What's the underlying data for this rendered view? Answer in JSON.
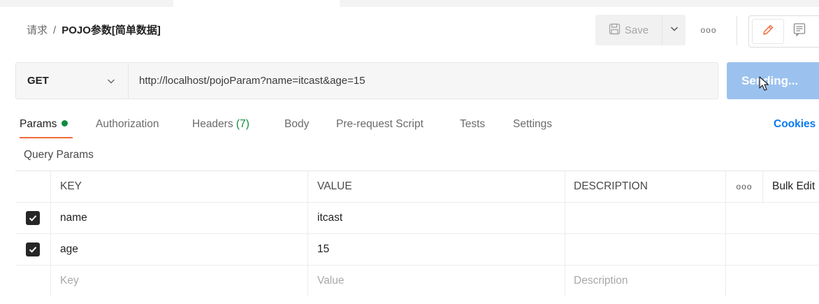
{
  "breadcrumb": {
    "parent": "请求",
    "separator": "/",
    "current": "POJO参数[简单数据]"
  },
  "toolbar": {
    "save_label": "Save",
    "more_label": "ooo"
  },
  "request": {
    "method": "GET",
    "url": "http://localhost/pojoParam?name=itcast&age=15",
    "send_label": "Sending..."
  },
  "tabs": [
    {
      "label": "Params",
      "active": true,
      "indicator": "green-dot"
    },
    {
      "label": "Authorization"
    },
    {
      "label": "Headers",
      "count": "(7)"
    },
    {
      "label": "Body"
    },
    {
      "label": "Pre-request Script"
    },
    {
      "label": "Tests"
    },
    {
      "label": "Settings"
    }
  ],
  "cookies_label": "Cookies",
  "query_params": {
    "title": "Query Params",
    "columns": {
      "key": "KEY",
      "value": "VALUE",
      "description": "DESCRIPTION",
      "more": "ooo",
      "bulk": "Bulk Edit"
    },
    "rows": [
      {
        "checked": true,
        "key": "name",
        "value": "itcast",
        "description": ""
      },
      {
        "checked": true,
        "key": "age",
        "value": "15",
        "description": ""
      }
    ],
    "placeholders": {
      "key": "Key",
      "value": "Value",
      "description": "Description"
    }
  },
  "colors": {
    "accent_tab": "#f26b3a",
    "send_button": "#9bc2ef",
    "link": "#097bed",
    "status_green": "#0f8c3f"
  }
}
